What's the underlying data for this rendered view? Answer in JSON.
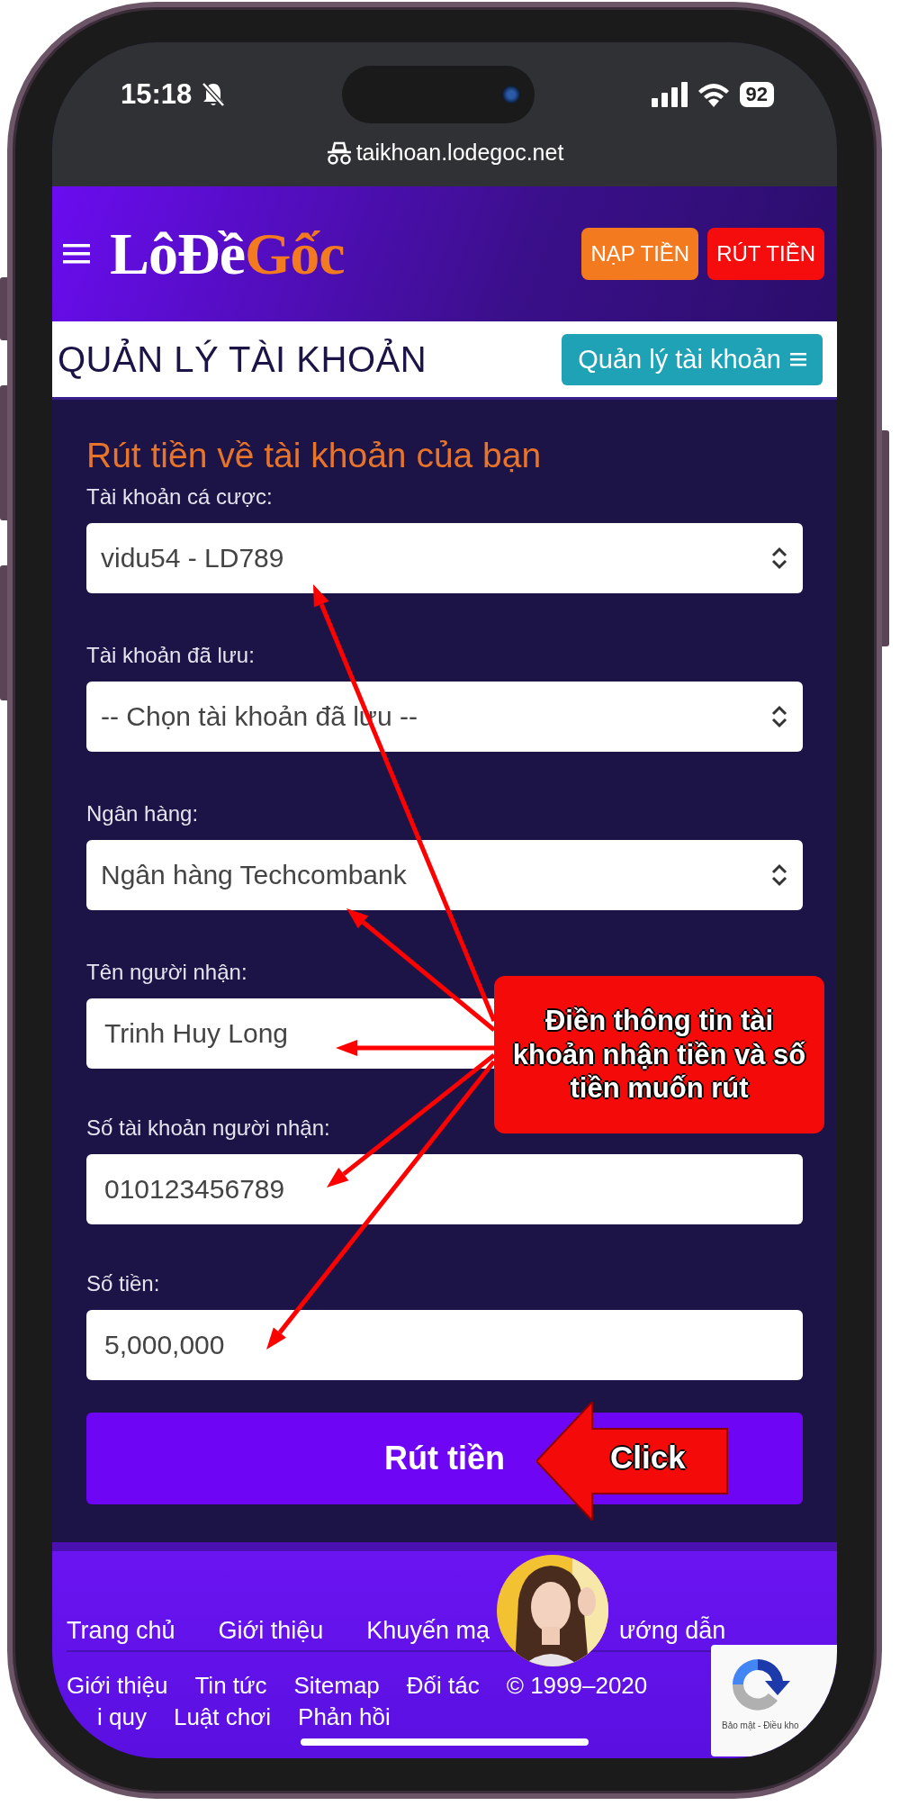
{
  "status_bar": {
    "time": "15:18",
    "battery": "92"
  },
  "browser": {
    "url": "taikhoan.lodegoc.net"
  },
  "header": {
    "logo": [
      "LôĐề",
      "Gốc"
    ],
    "buttons": [
      {
        "label": "NẠP TIỀN",
        "color": "#f47a1f"
      },
      {
        "label": "RÚT TIỀN",
        "color": "#f50d0d"
      }
    ]
  },
  "page_title": "QUẢN LÝ TÀI KHOẢN",
  "menu_button": "Quản lý tài khoản",
  "form": {
    "heading": "Rút tiền về tài khoản của bạn",
    "fields": [
      {
        "label": "Tài khoản cá cược:",
        "kind": "select",
        "value": "vidu54 - LD789"
      },
      {
        "label": "Tài khoản đã lưu:",
        "kind": "select",
        "value": "-- Chọn tài khoản đã lưu --"
      },
      {
        "label": "Ngân hàng:",
        "kind": "select",
        "value": "Ngân hàng Techcombank"
      },
      {
        "label": "Tên người nhận:",
        "kind": "input",
        "value": "Trinh Huy Long"
      },
      {
        "label": "Số tài khoản người nhận:",
        "kind": "input",
        "value": "010123456789"
      },
      {
        "label": "Số tiền:",
        "kind": "input",
        "value": "5,000,000"
      }
    ],
    "submit": "Rút tiền"
  },
  "annotations": {
    "callout": "Điền thông tin tài khoản nhận tiền và số tiền muốn rút",
    "click_label": "Click"
  },
  "footer": {
    "nav": [
      "Trang chủ",
      "Giới thiệu",
      "Khuyến mạ",
      "ướng dẫn"
    ],
    "links": [
      "Giới thiệu",
      "Tin tức",
      "Sitemap",
      "Đối tác",
      "© 1999–2020"
    ],
    "links_2": [
      "i quy",
      "Luật chơi",
      "Phản hồi"
    ]
  },
  "recaptcha": {
    "text": "Bảo mật - Điều kho"
  }
}
